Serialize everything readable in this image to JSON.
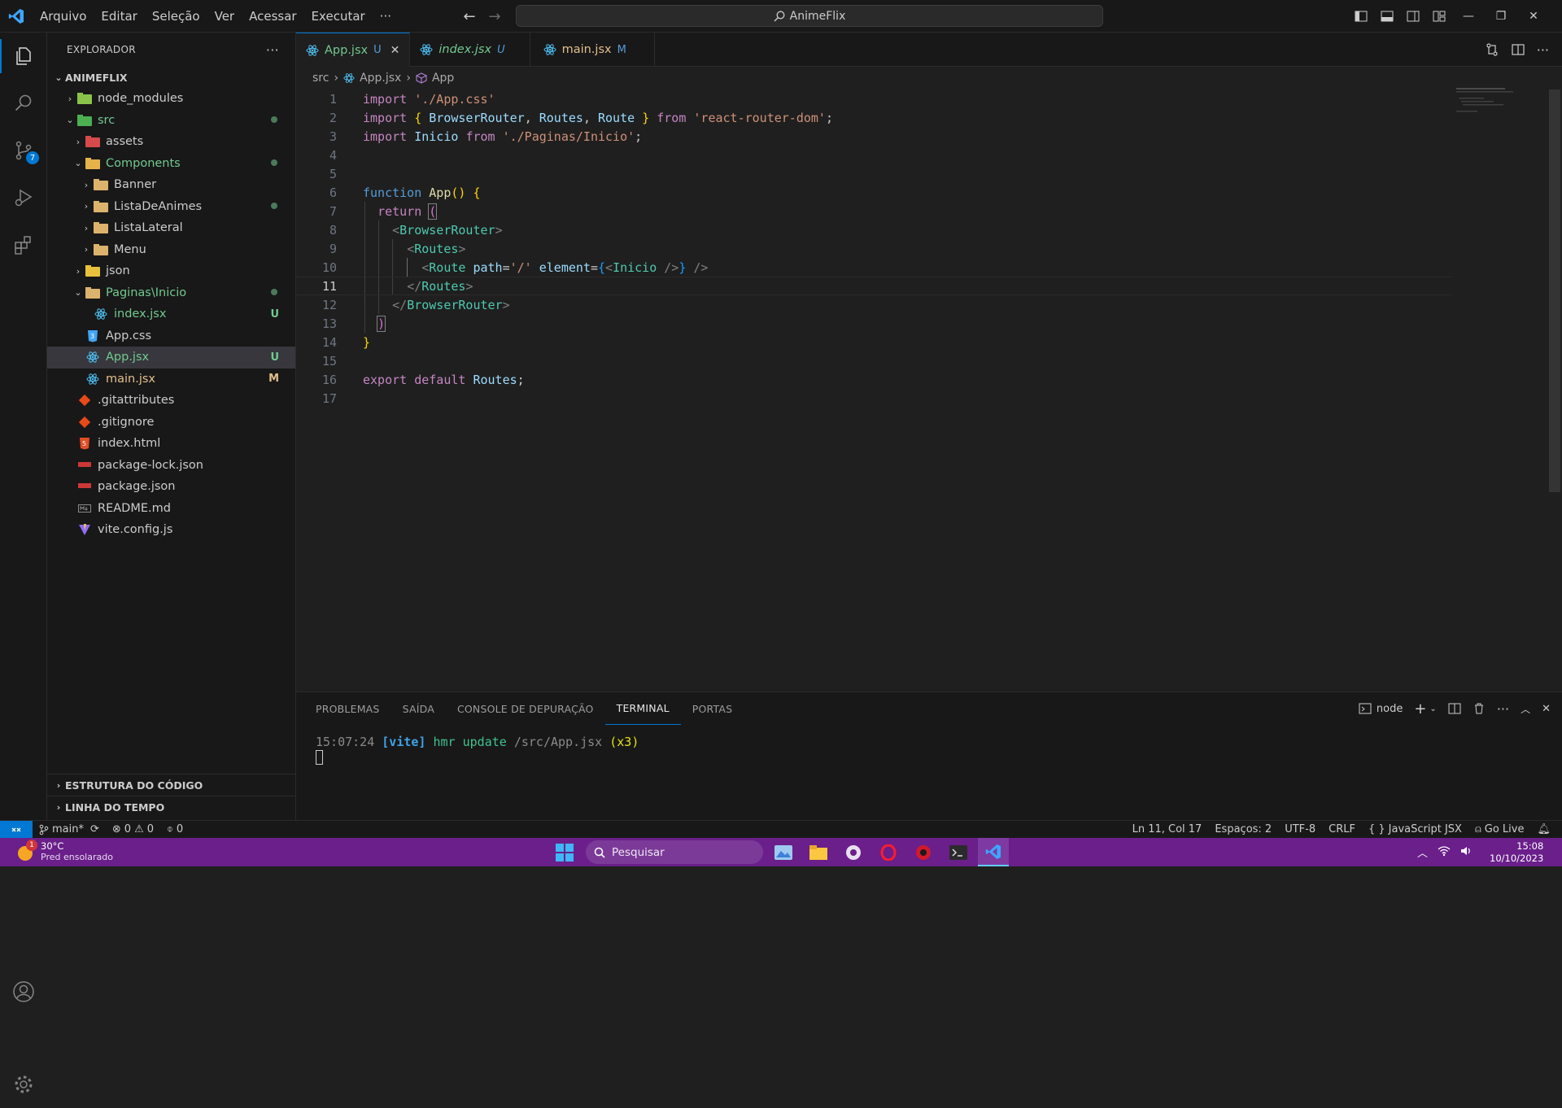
{
  "titlebar": {
    "menu": [
      "Arquivo",
      "Editar",
      "Seleção",
      "Ver",
      "Acessar",
      "Executar",
      "···"
    ],
    "search": "AnimeFlix"
  },
  "activity": {
    "source_control_badge": "7"
  },
  "sidebar": {
    "header": "EXPLORADOR",
    "more": "···",
    "project": "ANIMEFLIX",
    "tree": [
      {
        "label": "node_modules",
        "deco": ""
      },
      {
        "label": "src",
        "deco": ""
      },
      {
        "label": "assets",
        "deco": ""
      },
      {
        "label": "Components",
        "deco": ""
      },
      {
        "label": "Banner",
        "deco": ""
      },
      {
        "label": "ListaDeAnimes",
        "deco": ""
      },
      {
        "label": "ListaLateral",
        "deco": ""
      },
      {
        "label": "Menu",
        "deco": ""
      },
      {
        "label": "json",
        "deco": ""
      },
      {
        "label": "Paginas\\Inicio",
        "deco": ""
      },
      {
        "label": "index.jsx",
        "deco": "U"
      },
      {
        "label": "App.css",
        "deco": ""
      },
      {
        "label": "App.jsx",
        "deco": "U"
      },
      {
        "label": "main.jsx",
        "deco": "M"
      },
      {
        "label": ".gitattributes",
        "deco": ""
      },
      {
        "label": ".gitignore",
        "deco": ""
      },
      {
        "label": "index.html",
        "deco": ""
      },
      {
        "label": "package-lock.json",
        "deco": ""
      },
      {
        "label": "package.json",
        "deco": ""
      },
      {
        "label": "README.md",
        "deco": ""
      },
      {
        "label": "vite.config.js",
        "deco": ""
      }
    ],
    "outline": "ESTRUTURA DO CÓDIGO",
    "timeline": "LINHA DO TEMPO"
  },
  "tabs": [
    {
      "label": "App.jsx",
      "tag": "U"
    },
    {
      "label": "index.jsx",
      "tag": "U"
    },
    {
      "label": "main.jsx",
      "tag": "M"
    }
  ],
  "breadcrumb": [
    "src",
    "App.jsx",
    "App"
  ],
  "editor": {
    "line_numbers": [
      "1",
      "2",
      "3",
      "4",
      "5",
      "6",
      "7",
      "8",
      "9",
      "10",
      "11",
      "12",
      "13",
      "14",
      "15",
      "16",
      "17"
    ],
    "t": {
      "import": "import",
      "from": "from",
      "function": "function",
      "return": "return",
      "export": "export",
      "default": "default",
      "app_css": "'./App.css'",
      "react_router": "'react-router-dom'",
      "inicio_path": "'./Paginas/Inicio'",
      "browser_router": "BrowserRouter",
      "routes": "Routes",
      "route": "Route",
      "inicio": "Inicio",
      "app": "App",
      "path": "path",
      "element": "element",
      "slash": "'/'"
    }
  },
  "panel": {
    "tabs": [
      "PROBLEMAS",
      "SAÍDA",
      "CONSOLE DE DEPURAÇÃO",
      "TERMINAL",
      "PORTAS"
    ],
    "shell": "node",
    "terminal": {
      "time": "15:07:24",
      "vite": "[vite]",
      "msg": "hmr update",
      "file": "/src/App.jsx",
      "count": "(x3)"
    }
  },
  "status": {
    "branch": "main*",
    "errors": "0",
    "warnings": "0",
    "ports": "0",
    "position": "Ln 11, Col 17",
    "spaces": "Espaços: 2",
    "encoding": "UTF-8",
    "eol": "CRLF",
    "language": "JavaScript JSX",
    "golive": "Go Live"
  },
  "taskbar": {
    "temp": "30°C",
    "weather": "Pred ensolarado",
    "weather_badge": "1",
    "search": "Pesquisar",
    "time": "15:08",
    "date": "10/10/2023"
  },
  "colors": {
    "accent": "#0078d4",
    "taskbar": "#6a1f8a",
    "untracked": "#73c991",
    "modified": "#e2c08d"
  }
}
